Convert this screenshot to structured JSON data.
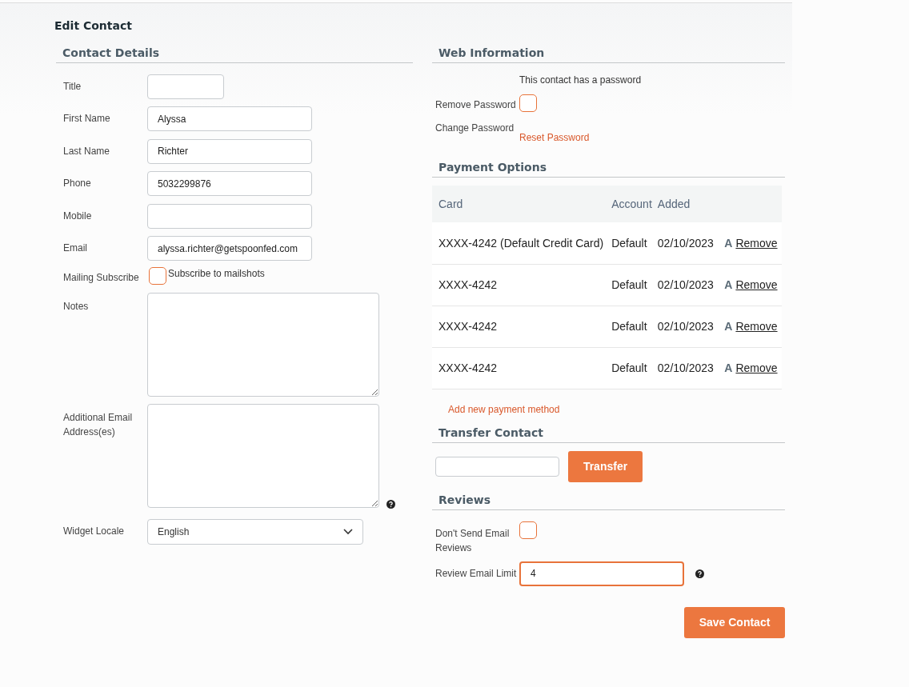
{
  "page_title": "Edit Contact",
  "contact_details": {
    "heading": "Contact Details",
    "fields": [
      {
        "kind": "short",
        "label": "Title"
      },
      {
        "kind": "text",
        "label": "First Name",
        "value": "Alyssa"
      },
      {
        "kind": "text",
        "label": "Last Name",
        "value": "Richter"
      },
      {
        "kind": "text",
        "label": "Phone",
        "value": "5032299876"
      },
      {
        "kind": "text",
        "label": "Mobile"
      },
      {
        "kind": "text",
        "label": "Email",
        "value": "alyssa.richter@getspoonfed.com"
      },
      {
        "kind": "checkbox",
        "label": "Mailing Subscribe",
        "checked": false,
        "text": "Subscribe to mailshots"
      },
      {
        "kind": "textarea",
        "label": "Notes",
        "help": false
      },
      {
        "kind": "textarea",
        "label": "Additional Email Address(es)",
        "help": true
      },
      {
        "kind": "select",
        "label": "Widget Locale",
        "value": "English"
      }
    ]
  },
  "web_information": {
    "heading": "Web Information",
    "note": "This contact has a password",
    "remove_password": {
      "label": "Remove Password",
      "checked": false
    },
    "change_password": {
      "label": "Change Password",
      "link": "Reset Password"
    }
  },
  "payment_options": {
    "heading": "Payment Options",
    "columns": [
      "Card",
      "Account",
      "Added"
    ],
    "rows": [
      {
        "card": "XXXX-4242 (Default Credit Card)",
        "account": "Default",
        "added": "02/10/2023",
        "badge": "A",
        "action": "Remove"
      },
      {
        "card": "XXXX-4242",
        "account": "Default",
        "added": "02/10/2023",
        "badge": "A",
        "action": "Remove"
      },
      {
        "card": "XXXX-4242",
        "account": "Default",
        "added": "02/10/2023",
        "badge": "A",
        "action": "Remove"
      },
      {
        "card": "XXXX-4242",
        "account": "Default",
        "added": "02/10/2023",
        "badge": "A",
        "action": "Remove"
      }
    ],
    "add_link": "Add new payment method"
  },
  "transfer_contact": {
    "heading": "Transfer Contact",
    "button": "Transfer"
  },
  "reviews": {
    "heading": "Reviews",
    "dont_send": {
      "label": "Don't Send Email Reviews",
      "checked": false
    },
    "limit": {
      "label": "Review Email Limit",
      "value": "4",
      "focused": true,
      "help": true
    }
  },
  "save_button": "Save Contact"
}
